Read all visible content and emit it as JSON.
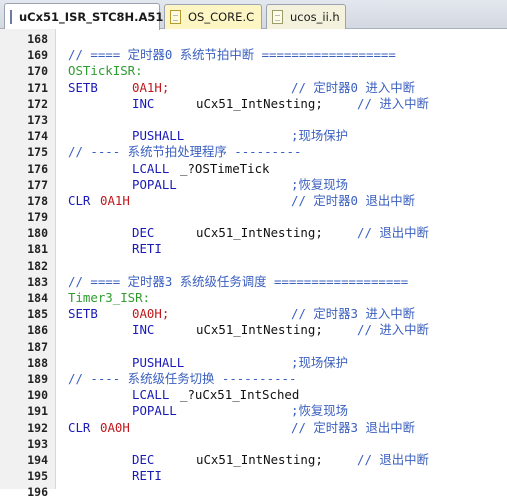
{
  "tabs": [
    {
      "label": "uCx51_ISR_STC8H.A51",
      "active": true
    },
    {
      "label": "OS_CORE.C",
      "active": false
    },
    {
      "label": "ucos_ii.h",
      "active": false
    }
  ],
  "colors": {
    "comment": "#3a5fbf",
    "label": "#2e9c2e",
    "keyword": "#1a1ab8",
    "number": "#c0181c",
    "plain": "#111111"
  },
  "lines": [
    {
      "n": "168",
      "segs": []
    },
    {
      "n": "169",
      "segs": [
        {
          "c": "comment",
          "t": "// ==== 定时器0 系统节拍中断 =================="
        }
      ]
    },
    {
      "n": "170",
      "segs": [
        {
          "c": "label",
          "t": "OSTickISR:"
        }
      ]
    },
    {
      "n": "171",
      "segs": [
        {
          "c": "kw",
          "t": "SETB"
        },
        {
          "c": "num",
          "t": "0A1H;"
        },
        {
          "c": "comment",
          "t": "// 定时器0 进入中断"
        }
      ]
    },
    {
      "n": "172",
      "segs": [
        {
          "c": "kw",
          "t": "INC"
        },
        {
          "c": "plain",
          "t": "uCx51_IntNesting;"
        },
        {
          "c": "comment",
          "t": "// 进入中断"
        }
      ]
    },
    {
      "n": "173",
      "segs": []
    },
    {
      "n": "174",
      "segs": [
        {
          "c": "kw",
          "t": "PUSHALL"
        },
        {
          "c": "comment",
          "t": ";现场保护"
        }
      ]
    },
    {
      "n": "175",
      "segs": [
        {
          "c": "comment",
          "t": "// ---- 系统节拍处理程序 ---------"
        }
      ]
    },
    {
      "n": "176",
      "segs": [
        {
          "c": "kw",
          "t": "LCALL"
        },
        {
          "c": "plain",
          "t": "_?OSTimeTick"
        }
      ]
    },
    {
      "n": "177",
      "segs": [
        {
          "c": "kw",
          "t": "POPALL"
        },
        {
          "c": "comment",
          "t": ";恢复现场"
        }
      ]
    },
    {
      "n": "178",
      "segs": [
        {
          "c": "kw",
          "t": "CLR"
        },
        {
          "c": "num",
          "t": "0A1H"
        },
        {
          "c": "comment",
          "t": "// 定时器0 退出中断"
        }
      ]
    },
    {
      "n": "179",
      "segs": []
    },
    {
      "n": "180",
      "segs": [
        {
          "c": "kw",
          "t": "DEC"
        },
        {
          "c": "plain",
          "t": "uCx51_IntNesting;"
        },
        {
          "c": "comment",
          "t": "// 退出中断"
        }
      ]
    },
    {
      "n": "181",
      "segs": [
        {
          "c": "kw",
          "t": "RETI"
        }
      ]
    },
    {
      "n": "182",
      "segs": []
    },
    {
      "n": "183",
      "segs": [
        {
          "c": "comment",
          "t": "// ==== 定时器3 系统级任务调度 =================="
        }
      ]
    },
    {
      "n": "184",
      "segs": [
        {
          "c": "label",
          "t": "Timer3_ISR:"
        }
      ]
    },
    {
      "n": "185",
      "segs": [
        {
          "c": "kw",
          "t": "SETB"
        },
        {
          "c": "num",
          "t": "0A0H;"
        },
        {
          "c": "comment",
          "t": "// 定时器3 进入中断"
        }
      ]
    },
    {
      "n": "186",
      "segs": [
        {
          "c": "kw",
          "t": "INC"
        },
        {
          "c": "plain",
          "t": "uCx51_IntNesting;"
        },
        {
          "c": "comment",
          "t": "// 进入中断"
        }
      ]
    },
    {
      "n": "187",
      "segs": []
    },
    {
      "n": "188",
      "segs": [
        {
          "c": "kw",
          "t": "PUSHALL"
        },
        {
          "c": "comment",
          "t": ";现场保护"
        }
      ]
    },
    {
      "n": "189",
      "segs": [
        {
          "c": "comment",
          "t": "// ---- 系统级任务切换 ----------"
        }
      ]
    },
    {
      "n": "190",
      "segs": [
        {
          "c": "kw",
          "t": "LCALL"
        },
        {
          "c": "plain",
          "t": "_?uCx51_IntSched"
        }
      ]
    },
    {
      "n": "191",
      "segs": [
        {
          "c": "kw",
          "t": "POPALL"
        },
        {
          "c": "comment",
          "t": ";恢复现场"
        }
      ]
    },
    {
      "n": "192",
      "segs": [
        {
          "c": "kw",
          "t": "CLR"
        },
        {
          "c": "num",
          "t": "0A0H"
        },
        {
          "c": "comment",
          "t": "// 定时器3 退出中断"
        }
      ]
    },
    {
      "n": "193",
      "segs": []
    },
    {
      "n": "194",
      "segs": [
        {
          "c": "kw",
          "t": "DEC"
        },
        {
          "c": "plain",
          "t": "uCx51_IntNesting;"
        },
        {
          "c": "comment",
          "t": "// 退出中断"
        }
      ]
    },
    {
      "n": "195",
      "segs": [
        {
          "c": "kw",
          "t": "RETI"
        }
      ]
    },
    {
      "n": "196",
      "segs": []
    }
  ]
}
